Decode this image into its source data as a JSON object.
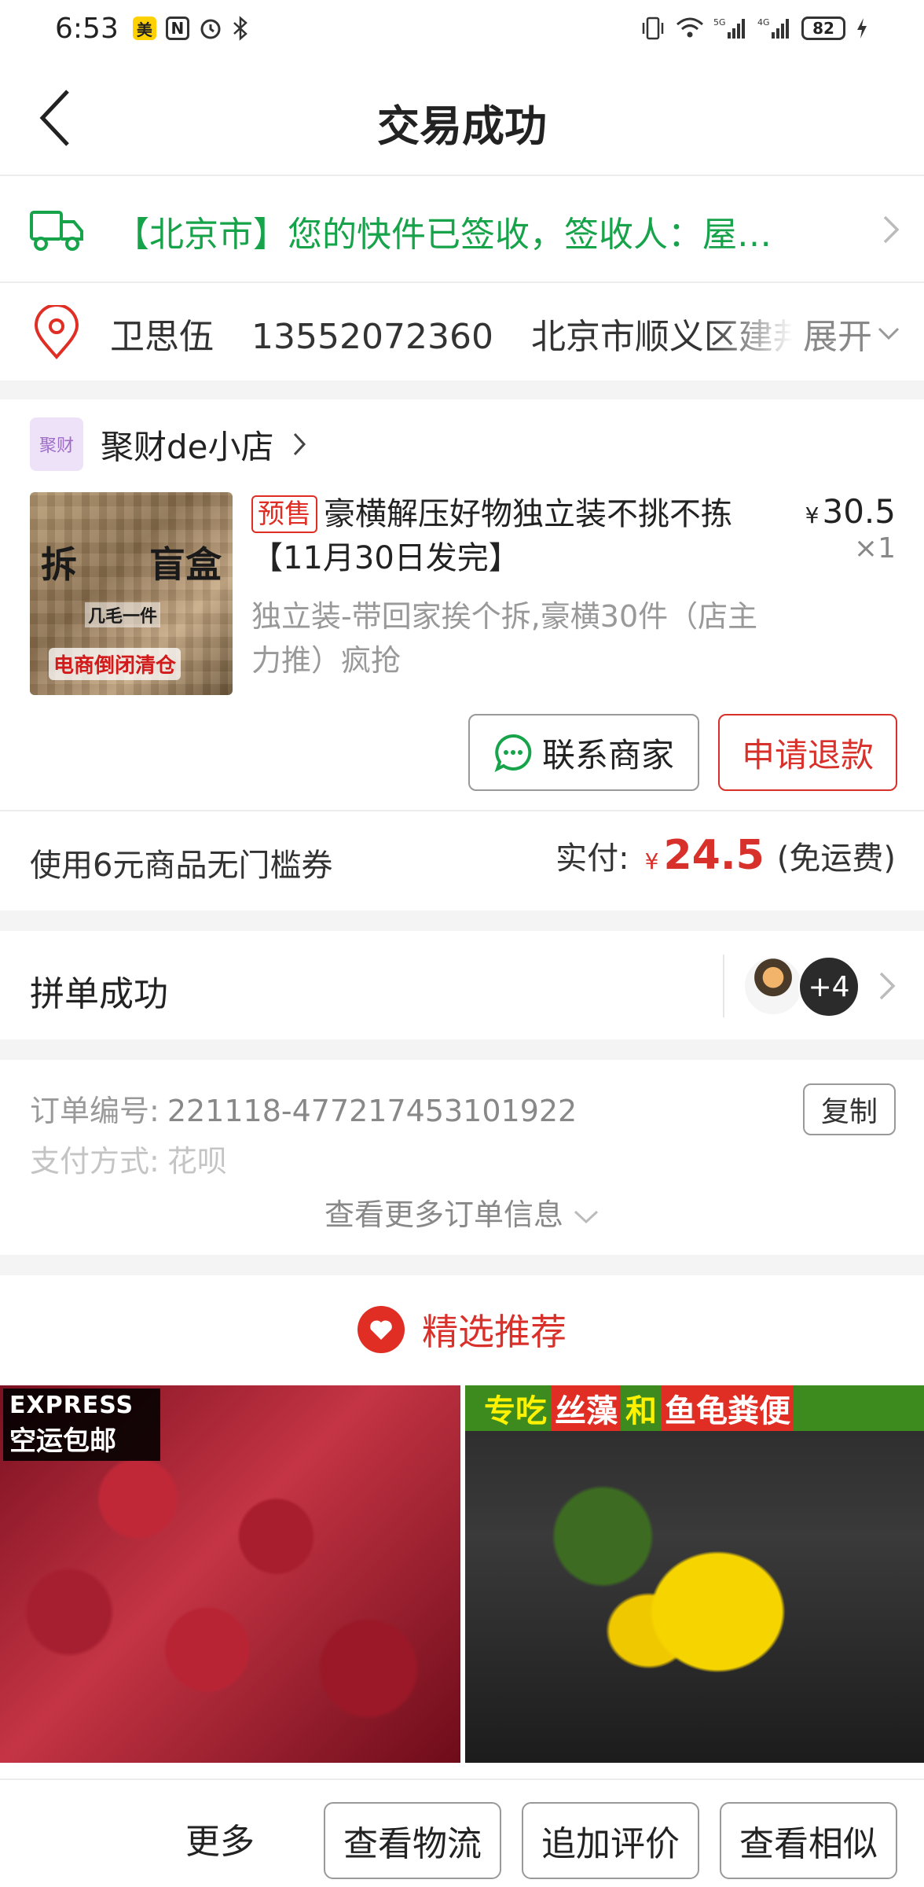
{
  "status_bar": {
    "time": "6:53",
    "battery": "82"
  },
  "header": {
    "title": "交易成功"
  },
  "logistics": {
    "text": "【北京市】您的快件已签收，签收人：屋…"
  },
  "address": {
    "name": "卫思伍",
    "phone": "13552072360",
    "address": "北京市顺义区建邦",
    "expand_label": "展开"
  },
  "order": {
    "shop_name": "聚财de小店",
    "shop_logo_text": "聚财",
    "presale_tag": "预售",
    "title": "豪横解压好物独立装不挑不拣【11月30日发完】",
    "price_symbol": "¥",
    "price": "30.5",
    "quantity": "×1",
    "sku": "独立装-带回家挨个拆,豪横30件（店主力推）疯抢",
    "image": {
      "label_left": "拆",
      "label_right": "盲盒",
      "sub": "几毛一件",
      "banner": "电商倒闭清仓"
    },
    "contact_label": "联系商家",
    "refund_label": "申请退款",
    "coupon_text": "使用6元商品无门槛券",
    "paid_label": "实付:",
    "paid_symbol": "¥",
    "paid_amount": "24.5",
    "shipping_note": "(免运费)"
  },
  "group": {
    "title": "拼单成功",
    "more_count": "+4"
  },
  "order_info": {
    "order_no_label": "订单编号:",
    "order_no": "221118-477217453101922",
    "copy_label": "复制",
    "payment_label": "支付方式:",
    "payment": "花呗",
    "more_label": "查看更多订单信息"
  },
  "recommend": {
    "title": "精选推荐",
    "items": [
      {
        "badge_line1": "EXPRESS",
        "badge_line2": "空运包邮"
      },
      {
        "banner_parts": [
          "专吃",
          "丝藻",
          "和",
          "鱼龟粪便"
        ]
      }
    ]
  },
  "bottom_bar": {
    "more_label": "更多",
    "logistics_label": "查看物流",
    "review_label": "追加评价",
    "similar_label": "查看相似"
  },
  "colors": {
    "accent_red": "#d8302a",
    "logistics_green": "#16a34a"
  }
}
